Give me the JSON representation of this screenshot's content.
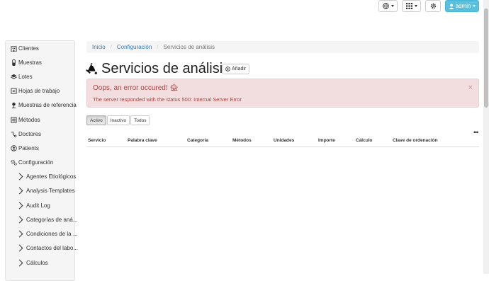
{
  "toolbar": {
    "user_label": "admin"
  },
  "sidebar": {
    "items": [
      {
        "label": "Clientes",
        "icon": "building-icon"
      },
      {
        "label": "Muestras",
        "icon": "sample-icon"
      },
      {
        "label": "Lotes",
        "icon": "layers-icon"
      },
      {
        "label": "Hojas de trabajo",
        "icon": "worksheet-icon"
      },
      {
        "label": "Muestras de referencia",
        "icon": "reference-icon"
      },
      {
        "label": "Métodos",
        "icon": "list-icon"
      },
      {
        "label": "Doctores",
        "icon": "doctor-icon"
      },
      {
        "label": "Patients",
        "icon": "patient-icon"
      },
      {
        "label": "Configuración",
        "icon": "gears-icon"
      }
    ],
    "sub_items": [
      {
        "label": "Agentes Etiológicos"
      },
      {
        "label": "Analysis Templates"
      },
      {
        "label": "Audit Log"
      },
      {
        "label": "Categorías de aná..."
      },
      {
        "label": "Condiciones de la ..."
      },
      {
        "label": "Contactos del labo..."
      },
      {
        "label": "Cálculos"
      }
    ]
  },
  "breadcrumb": {
    "home": "Inicio",
    "config": "Configuración",
    "current": "Servicios de análisis"
  },
  "page": {
    "title": "Servicios de análisis",
    "add_label": "Añadir"
  },
  "alert": {
    "heading": "Oops, an error occured! 🏚",
    "message": "The server responded with the status 500: Internal Server Error",
    "close": "×"
  },
  "filters": {
    "active": "Activo",
    "inactive": "Inactivo",
    "all": "Todos"
  },
  "table": {
    "more": "•••",
    "columns": [
      "Servicio",
      "Palabra clave",
      "Categoría",
      "Métodos",
      "Unidades",
      "Importe",
      "Cálculo",
      "Clave de ordenación"
    ]
  },
  "colors": {
    "primary_link": "#337ab7",
    "admin_button": "#5bc0de",
    "alert_bg": "#f2dede",
    "alert_text": "#a94442"
  }
}
